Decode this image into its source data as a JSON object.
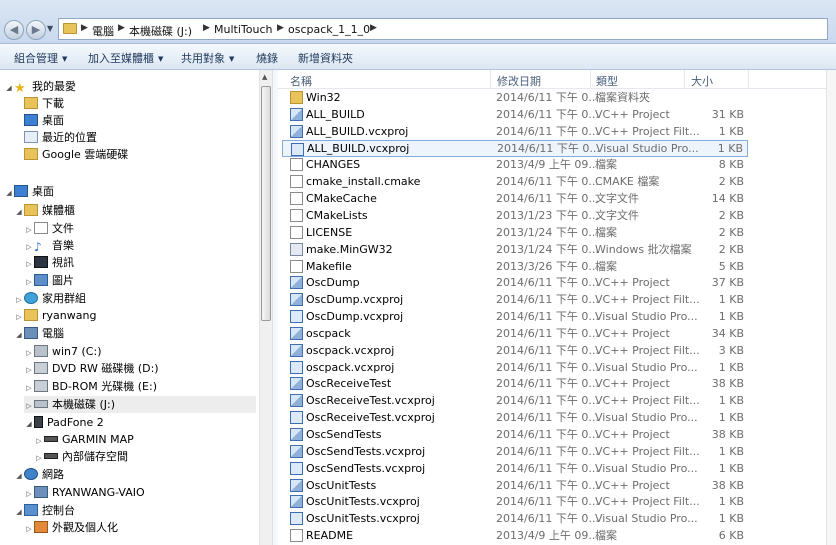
{
  "address": {
    "crumbs": [
      "電腦",
      "本機磁碟 (J:)",
      "MultiTouch",
      "oscpack_1_1_0"
    ]
  },
  "toolbar": {
    "organize": "組合管理",
    "include_library": "加入至媒體櫃",
    "share": "共用對象",
    "burn": "燒錄",
    "new_folder": "新增資料夾"
  },
  "nav": {
    "favorites": "我的最愛",
    "downloads": "下載",
    "desktop_fav": "桌面",
    "recent": "最近的位置",
    "google_drive": "Google 雲端硬碟",
    "desktop": "桌面",
    "libraries": "媒體櫃",
    "documents": "文件",
    "music": "音樂",
    "videos": "視訊",
    "pictures": "圖片",
    "homegroup": "家用群組",
    "user": "ryanwang",
    "computer": "電腦",
    "drive_c": "win7 (C:)",
    "drive_d": "DVD RW 磁碟機 (D:)",
    "drive_e": "BD-ROM 光碟機 (E:)",
    "drive_j": "本機磁碟 (J:)",
    "padfone": "PadFone 2",
    "garmin": "GARMIN MAP",
    "internal": "內部儲存空間",
    "network": "網路",
    "network_pc": "RYANWANG-VAIO",
    "control_panel": "控制台",
    "appearance": "外觀及個人化"
  },
  "columns": {
    "name": "名稱",
    "date": "修改日期",
    "type": "類型",
    "size": "大小"
  },
  "files": [
    {
      "name": "Win32",
      "date": "2014/6/11 下午 0...",
      "type": "檔案資料夾",
      "size": "",
      "icon": "folder-icon"
    },
    {
      "name": "ALL_BUILD",
      "date": "2014/6/11 下午 0...",
      "type": "VC++ Project",
      "size": "31 KB",
      "icon": "vcxproj-icon"
    },
    {
      "name": "ALL_BUILD.vcxproj",
      "date": "2014/6/11 下午 0...",
      "type": "VC++ Project Filt...",
      "size": "1 KB",
      "icon": "vcxproj-icon"
    },
    {
      "name": "ALL_BUILD.vcxproj",
      "date": "2014/6/11 下午 0...",
      "type": "Visual Studio Pro...",
      "size": "1 KB",
      "icon": "vs-project-icon"
    },
    {
      "name": "CHANGES",
      "date": "2013/4/9 上午 09...",
      "type": "檔案",
      "size": "8 KB",
      "icon": "document-icon"
    },
    {
      "name": "cmake_install.cmake",
      "date": "2014/6/11 下午 0...",
      "type": "CMAKE 檔案",
      "size": "2 KB",
      "icon": "document-icon"
    },
    {
      "name": "CMakeCache",
      "date": "2014/6/11 下午 0...",
      "type": "文字文件",
      "size": "14 KB",
      "icon": "document-icon"
    },
    {
      "name": "CMakeLists",
      "date": "2013/1/23 下午 0...",
      "type": "文字文件",
      "size": "2 KB",
      "icon": "document-icon"
    },
    {
      "name": "LICENSE",
      "date": "2013/1/24 下午 0...",
      "type": "檔案",
      "size": "2 KB",
      "icon": "document-icon"
    },
    {
      "name": "make.MinGW32",
      "date": "2013/1/24 下午 0...",
      "type": "Windows 批次檔案",
      "size": "2 KB",
      "icon": "batch-file-icon"
    },
    {
      "name": "Makefile",
      "date": "2013/3/26 下午 0...",
      "type": "檔案",
      "size": "5 KB",
      "icon": "document-icon"
    },
    {
      "name": "OscDump",
      "date": "2014/6/11 下午 0...",
      "type": "VC++ Project",
      "size": "37 KB",
      "icon": "vcxproj-icon"
    },
    {
      "name": "OscDump.vcxproj",
      "date": "2014/6/11 下午 0...",
      "type": "VC++ Project Filt...",
      "size": "1 KB",
      "icon": "vcxproj-icon"
    },
    {
      "name": "OscDump.vcxproj",
      "date": "2014/6/11 下午 0...",
      "type": "Visual Studio Pro...",
      "size": "1 KB",
      "icon": "vs-project-icon"
    },
    {
      "name": "oscpack",
      "date": "2014/6/11 下午 0...",
      "type": "VC++ Project",
      "size": "34 KB",
      "icon": "vcxproj-icon"
    },
    {
      "name": "oscpack.vcxproj",
      "date": "2014/6/11 下午 0...",
      "type": "VC++ Project Filt...",
      "size": "3 KB",
      "icon": "vcxproj-icon"
    },
    {
      "name": "oscpack.vcxproj",
      "date": "2014/6/11 下午 0...",
      "type": "Visual Studio Pro...",
      "size": "1 KB",
      "icon": "vs-project-icon"
    },
    {
      "name": "OscReceiveTest",
      "date": "2014/6/11 下午 0...",
      "type": "VC++ Project",
      "size": "38 KB",
      "icon": "vcxproj-icon"
    },
    {
      "name": "OscReceiveTest.vcxproj",
      "date": "2014/6/11 下午 0...",
      "type": "VC++ Project Filt...",
      "size": "1 KB",
      "icon": "vcxproj-icon"
    },
    {
      "name": "OscReceiveTest.vcxproj",
      "date": "2014/6/11 下午 0...",
      "type": "Visual Studio Pro...",
      "size": "1 KB",
      "icon": "vs-project-icon"
    },
    {
      "name": "OscSendTests",
      "date": "2014/6/11 下午 0...",
      "type": "VC++ Project",
      "size": "38 KB",
      "icon": "vcxproj-icon"
    },
    {
      "name": "OscSendTests.vcxproj",
      "date": "2014/6/11 下午 0...",
      "type": "VC++ Project Filt...",
      "size": "1 KB",
      "icon": "vcxproj-icon"
    },
    {
      "name": "OscSendTests.vcxproj",
      "date": "2014/6/11 下午 0...",
      "type": "Visual Studio Pro...",
      "size": "1 KB",
      "icon": "vs-project-icon"
    },
    {
      "name": "OscUnitTests",
      "date": "2014/6/11 下午 0...",
      "type": "VC++ Project",
      "size": "38 KB",
      "icon": "vcxproj-icon"
    },
    {
      "name": "OscUnitTests.vcxproj",
      "date": "2014/6/11 下午 0...",
      "type": "VC++ Project Filt...",
      "size": "1 KB",
      "icon": "vcxproj-icon"
    },
    {
      "name": "OscUnitTests.vcxproj",
      "date": "2014/6/11 下午 0...",
      "type": "Visual Studio Pro...",
      "size": "1 KB",
      "icon": "vs-project-icon"
    },
    {
      "name": "README",
      "date": "2013/4/9 上午 09...",
      "type": "檔案",
      "size": "6 KB",
      "icon": "document-icon"
    }
  ]
}
